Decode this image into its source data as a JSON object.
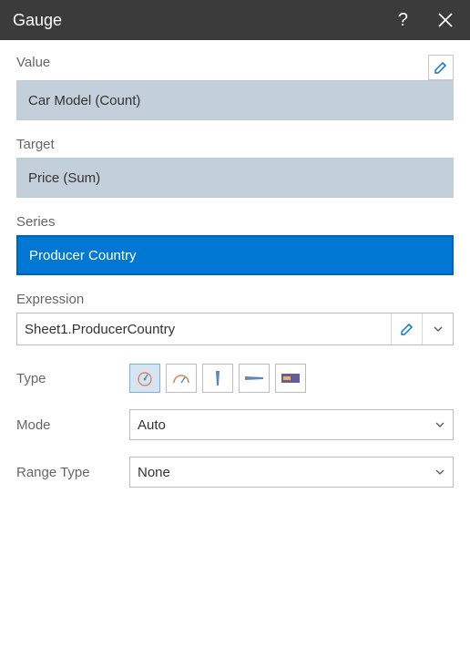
{
  "titlebar": {
    "title": "Gauge"
  },
  "labels": {
    "value": "Value",
    "target": "Target",
    "series": "Series",
    "expression": "Expression",
    "type": "Type",
    "mode": "Mode",
    "range_type": "Range Type"
  },
  "fields": {
    "value": "Car Model (Count)",
    "target": "Price (Sum)",
    "series": "Producer Country"
  },
  "expression": {
    "value": "Sheet1.ProducerCountry"
  },
  "mode": {
    "selected": "Auto"
  },
  "range_type": {
    "selected": "None"
  },
  "icons": {
    "pencil": "pencil-icon",
    "close": "close-icon",
    "help": "help-icon",
    "chevron": "chevron-down-icon"
  },
  "gauge_types": {
    "circular_full": "gauge-full-circle-icon",
    "circular_half": "gauge-half-circle-icon",
    "linear_vertical": "gauge-linear-vertical-icon",
    "linear_horizontal": "gauge-linear-horizontal-icon",
    "card": "gauge-card-icon"
  }
}
